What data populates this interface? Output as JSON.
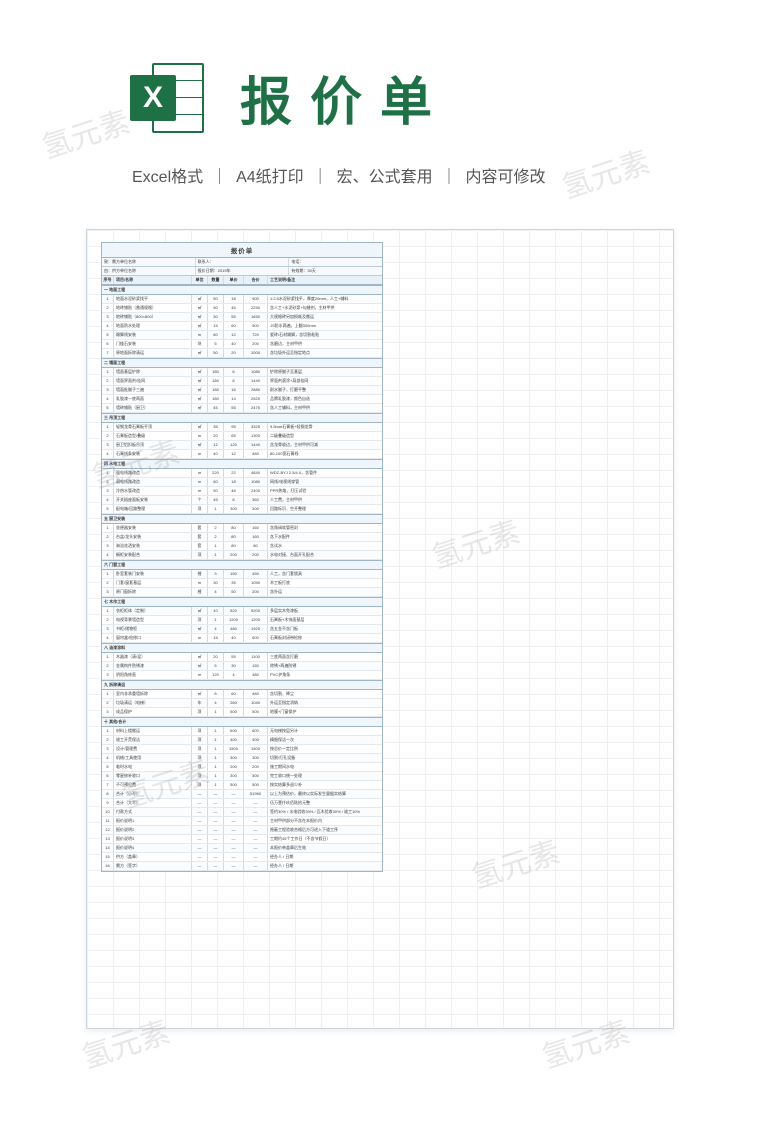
{
  "header": {
    "logo_letter": "X",
    "title": "报价单"
  },
  "subtitle": {
    "s1": "Excel格式",
    "sep": "｜",
    "s2": "A4纸打印",
    "s3": "宏、公式套用",
    "s4": "内容可修改"
  },
  "watermark": "氢元素",
  "sheet": {
    "title": "报价单",
    "meta1": {
      "a": "致：需方单位名称",
      "b": "联系人：",
      "c": "电话："
    },
    "meta2": {
      "a": "由：供方单位名称",
      "b": "报价日期：2019年",
      "c": "有效期：30天"
    },
    "columns": [
      "序号",
      "项目/名称",
      "单位",
      "数量",
      "单价",
      "合价",
      "工艺说明/备注"
    ],
    "sections": [
      {
        "name": "一  地面工程",
        "rows": [
          [
            "1",
            "地面水泥砂浆找平",
            "㎡",
            "50",
            "18",
            "900",
            "1:2.5水泥砂浆找平，厚度20mm，人工+辅料"
          ],
          [
            "2",
            "地砖铺贴（普通规格）",
            "㎡",
            "50",
            "45",
            "2250",
            "含人工+水泥砂浆+勾缝剂，主材甲供"
          ],
          [
            "3",
            "地砖铺贴（800×800）",
            "㎡",
            "30",
            "55",
            "1650",
            "大规格砖另加损耗及搬运"
          ],
          [
            "4",
            "地面防水处理",
            "㎡",
            "15",
            "60",
            "900",
            "JS防水两遍，上翻300mm"
          ],
          [
            "5",
            "踢脚线安装",
            "m",
            "60",
            "12",
            "720",
            "瓷砖/石材踢脚，含切割粘贴"
          ],
          [
            "6",
            "门槛石安装",
            "块",
            "5",
            "40",
            "200",
            "含磨边，主材甲供"
          ],
          [
            "7",
            "原地面拆除清运",
            "㎡",
            "50",
            "20",
            "1000",
            "含垃圾外运至指定地点"
          ]
        ]
      },
      {
        "name": "二  墙面工程",
        "rows": [
          [
            "1",
            "墙面基层铲除",
            "㎡",
            "180",
            "6",
            "1080",
            "铲除原腻子至基层"
          ],
          [
            "2",
            "墙面界面剂/挂网",
            "㎡",
            "180",
            "8",
            "1440",
            "界面剂滚涂+局部挂网"
          ],
          [
            "3",
            "墙面批腻子三遍",
            "㎡",
            "180",
            "16",
            "2880",
            "耐水腻子，打磨平整"
          ],
          [
            "4",
            "乳胶漆一底两面",
            "㎡",
            "180",
            "14",
            "2520",
            "品牌乳胶漆，颜色自选"
          ],
          [
            "5",
            "墙砖铺贴（厨卫）",
            "㎡",
            "45",
            "55",
            "2475",
            "含人工辅料，主材甲供"
          ]
        ]
      },
      {
        "name": "三  吊顶工程",
        "rows": [
          [
            "1",
            "轻钢龙骨石膏板平顶",
            "㎡",
            "35",
            "95",
            "3325",
            "9.5mm石膏板+轻钢龙骨"
          ],
          [
            "2",
            "石膏板造型/叠级",
            "m",
            "20",
            "65",
            "1300",
            "二级叠级造型"
          ],
          [
            "3",
            "厨卫铝扣板吊顶",
            "㎡",
            "12",
            "120",
            "1440",
            "含龙骨收边，主材甲供可减"
          ],
          [
            "4",
            "石膏线条安装",
            "m",
            "40",
            "12",
            "480",
            "80-100宽石膏线"
          ]
        ]
      },
      {
        "name": "四  水电工程",
        "rows": [
          [
            "1",
            "强电线路改造",
            "m",
            "220",
            "22",
            "4840",
            "WDZ-BYJ 2.5/4.0，含管件"
          ],
          [
            "2",
            "弱电线路改造",
            "m",
            "60",
            "18",
            "1080",
            "网线/电视线穿管"
          ],
          [
            "3",
            "冷热水管改造",
            "m",
            "50",
            "48",
            "2400",
            "PPR热熔，打压试验"
          ],
          [
            "4",
            "开关插座面板安装",
            "个",
            "45",
            "8",
            "360",
            "人工费，主材甲供"
          ],
          [
            "5",
            "配电箱/回路整理",
            "项",
            "1",
            "300",
            "300",
            "回路标识、空开整理"
          ]
        ]
      },
      {
        "name": "五  厨卫安装",
        "rows": [
          [
            "1",
            "坐便器安装",
            "套",
            "2",
            "80",
            "160",
            "含角阀软管密封"
          ],
          [
            "2",
            "台盆/龙头安装",
            "套",
            "2",
            "80",
            "160",
            "含下水配件"
          ],
          [
            "3",
            "淋浴花洒安装",
            "套",
            "1",
            "80",
            "80",
            "含试水"
          ],
          [
            "4",
            "橱柜安装配合",
            "项",
            "1",
            "200",
            "200",
            "水电对接、台面开孔配合"
          ]
        ]
      },
      {
        "name": "六  门窗工程",
        "rows": [
          [
            "1",
            "卧室套装门安装",
            "樘",
            "3",
            "150",
            "450",
            "人工，含门套锁具"
          ],
          [
            "2",
            "门套/窗套基层",
            "m",
            "30",
            "35",
            "1050",
            "木工板打底"
          ],
          [
            "3",
            "原门窗拆除",
            "樘",
            "4",
            "50",
            "200",
            "含外运"
          ]
        ]
      },
      {
        "name": "七  木作工程",
        "rows": [
          [
            "1",
            "衣柜柜体（定制）",
            "㎡",
            "10",
            "520",
            "5200",
            "多层实木免漆板"
          ],
          [
            "2",
            "电视背景墙造型",
            "项",
            "1",
            "1200",
            "1200",
            "石膏板+木饰面基层"
          ],
          [
            "3",
            "书柜/储物柜",
            "㎡",
            "4",
            "480",
            "1920",
            "含五金不含门板"
          ],
          [
            "4",
            "窗帘盒/检修口",
            "m",
            "15",
            "40",
            "600",
            "石膏板封闭带检修"
          ]
        ]
      },
      {
        "name": "八  油漆涂料",
        "rows": [
          [
            "1",
            "木器漆（清/混）",
            "㎡",
            "20",
            "55",
            "1100",
            "三底两面含打磨"
          ],
          [
            "2",
            "金属构件防锈漆",
            "㎡",
            "5",
            "30",
            "150",
            "除锈+两遍防锈"
          ],
          [
            "3",
            "阴阳角修直",
            "m",
            "120",
            "4",
            "480",
            "PVC护角条"
          ]
        ]
      },
      {
        "name": "九  拆除清运",
        "rows": [
          [
            "1",
            "室内非承重墙拆除",
            "㎡",
            "8",
            "60",
            "480",
            "含切割、降尘"
          ],
          [
            "2",
            "垃圾清运（电梯）",
            "车",
            "4",
            "260",
            "1040",
            "外运至指定消纳"
          ],
          [
            "3",
            "成品保护",
            "项",
            "1",
            "500",
            "500",
            "地膜+门窗保护"
          ]
        ]
      },
      {
        "name": "十  其他/合计",
        "rows": [
          [
            "1",
            "材料上楼搬运",
            "项",
            "1",
            "600",
            "600",
            "无电梯按层另计"
          ],
          [
            "2",
            "竣工开荒保洁",
            "项",
            "1",
            "400",
            "400",
            "精细保洁一次"
          ],
          [
            "3",
            "设计/管理费",
            "项",
            "1",
            "1500",
            "1500",
            "按总价一定比例"
          ],
          [
            "4",
            "机械/工具使用",
            "项",
            "1",
            "300",
            "300",
            "切割/打孔设备"
          ],
          [
            "5",
            "临时水电",
            "项",
            "1",
            "200",
            "200",
            "施工期间水电"
          ],
          [
            "6",
            "零星修补收口",
            "项",
            "1",
            "300",
            "300",
            "完工收口统一处理"
          ],
          [
            "7",
            "不可预见费",
            "项",
            "1",
            "500",
            "500",
            "按实结算多退少补"
          ],
          [
            "8",
            "合计（小写）",
            "—",
            "—",
            "—",
            "51960",
            "以上为预估价，最终以实际发生量据实结算"
          ],
          [
            "9",
            "合计（大写）",
            "—",
            "—",
            "—",
            "—",
            "伍万壹仟玖佰陆拾元整"
          ],
          [
            "10",
            "付款方式",
            "—",
            "—",
            "—",
            "—",
            "签约30% / 水电验收30% / 瓦木验收30% / 竣工10%"
          ],
          [
            "11",
            "报价说明1",
            "—",
            "—",
            "—",
            "—",
            "主材甲供部分不含在本报价内"
          ],
          [
            "12",
            "报价说明2",
            "—",
            "—",
            "—",
            "—",
            "隐蔽工程验收合格后方可进入下道工序"
          ],
          [
            "13",
            "报价说明3",
            "—",
            "—",
            "—",
            "—",
            "工期约45个工作日（不含节假日）"
          ],
          [
            "14",
            "报价说明4",
            "—",
            "—",
            "—",
            "—",
            "本报价单盖章后生效"
          ],
          [
            "15",
            "供方（盖章）",
            "—",
            "—",
            "—",
            "—",
            "经办人 / 日期"
          ],
          [
            "16",
            "需方（签字）",
            "—",
            "—",
            "—",
            "—",
            "经办人 / 日期"
          ]
        ]
      }
    ]
  }
}
